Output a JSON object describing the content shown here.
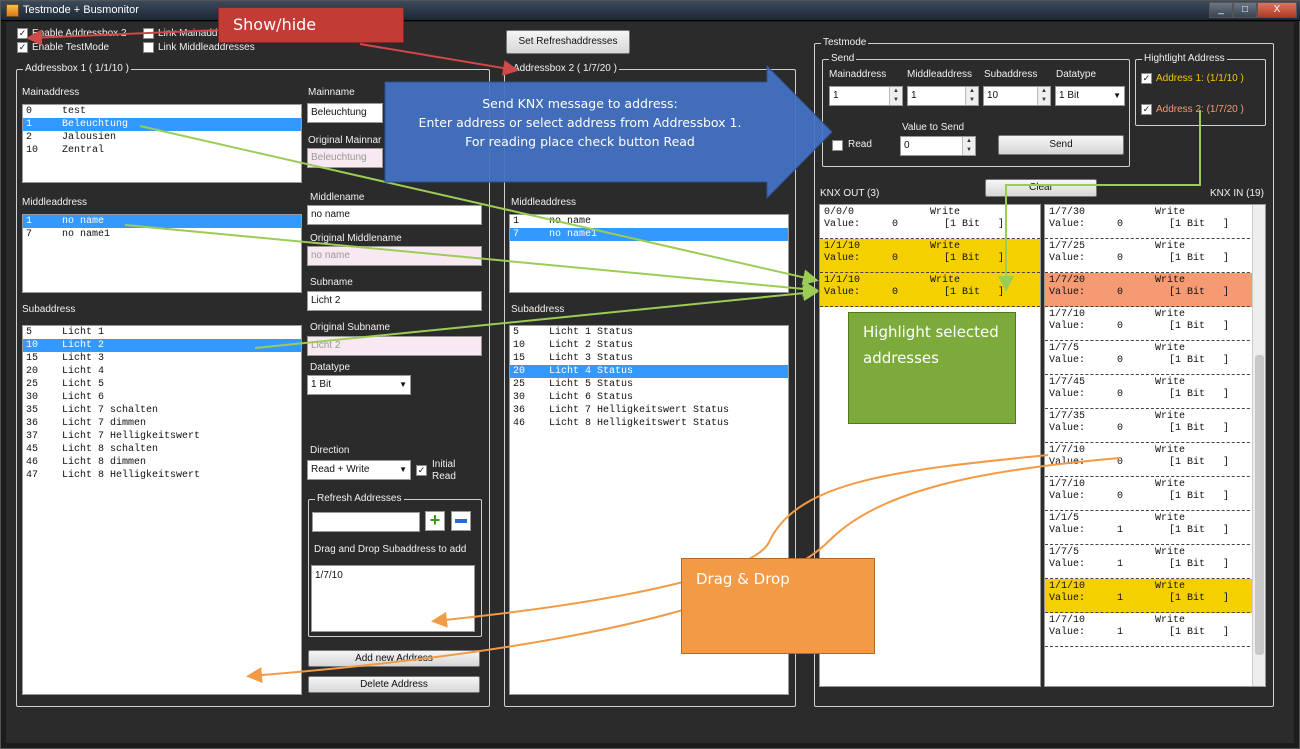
{
  "window": {
    "title": "Testmode + Busmonitor",
    "min": "_",
    "max": "□",
    "close": "X"
  },
  "toolbar": {
    "enable_addressbox2": "Enable Addressbox 2",
    "enable_testmode": "Enable TestMode",
    "link_mainaddresses": "Link Mainadd",
    "link_middleaddresses": "Link Middleaddresses",
    "set_refresh": "Set Refreshaddresses"
  },
  "addressbox1": {
    "title": "Addressbox 1 ( 1/1/10 )",
    "main_label": "Mainaddress",
    "main_items": [
      {
        "n": "0",
        "name": "test"
      },
      {
        "n": "1",
        "name": "Beleuchtung"
      },
      {
        "n": "2",
        "name": "Jalousien"
      },
      {
        "n": "10",
        "name": "Zentral"
      }
    ],
    "middle_label": "Middleaddress",
    "middle_items": [
      {
        "n": "1",
        "name": "no name"
      },
      {
        "n": "7",
        "name": "no name1"
      }
    ],
    "sub_label": "Subaddress",
    "sub_items": [
      {
        "n": "5",
        "name": "Licht 1"
      },
      {
        "n": "10",
        "name": "Licht 2"
      },
      {
        "n": "15",
        "name": "Licht 3"
      },
      {
        "n": "20",
        "name": "Licht 4"
      },
      {
        "n": "25",
        "name": "Licht 5"
      },
      {
        "n": "30",
        "name": "Licht 6"
      },
      {
        "n": "35",
        "name": "Licht 7 schalten"
      },
      {
        "n": "36",
        "name": "Licht 7 dimmen"
      },
      {
        "n": "37",
        "name": "Licht 7 Helligkeitswert"
      },
      {
        "n": "45",
        "name": "Licht 8 schalten"
      },
      {
        "n": "46",
        "name": "Licht 8 dimmen"
      },
      {
        "n": "47",
        "name": "Licht 8 Helligkeitswert"
      }
    ]
  },
  "details": {
    "mainname_label": "Mainname",
    "mainname_value": "Beleuchtung",
    "orig_mainname_label": "Original Mainnar",
    "orig_mainname_value": "Beleuchtung",
    "middlename_label": "Middlename",
    "middlename_value": "no name",
    "orig_middlename_label": "Original Middlename",
    "orig_middlename_value": "no name",
    "subname_label": "Subname",
    "subname_value": "Licht 2",
    "orig_subname_label": "Original Subname",
    "orig_subname_value": "Licht 2",
    "datatype_label": "Datatype",
    "datatype_value": "1 Bit",
    "direction_label": "Direction",
    "direction_value": "Read + Write",
    "initial_read": "Initial Read",
    "refresh_title": "Refresh Addresses",
    "dragdrop_hint": "Drag and Drop Subaddress to add",
    "refresh_items": [
      "1/7/10"
    ],
    "add_button": "Add new Address",
    "delete_button": "Delete Address"
  },
  "addressbox2": {
    "title": "Addressbox 2 ( 1/7/20 )",
    "middle_label": "Middleaddress",
    "middle_items": [
      {
        "n": "1",
        "name": "no name"
      },
      {
        "n": "7",
        "name": "no name1"
      }
    ],
    "sub_label": "Subaddress",
    "sub_items": [
      {
        "n": "5",
        "name": "Licht 1 Status"
      },
      {
        "n": "10",
        "name": "Licht 2 Status"
      },
      {
        "n": "15",
        "name": "Licht 3 Status"
      },
      {
        "n": "20",
        "name": "Licht 4 Status"
      },
      {
        "n": "25",
        "name": "Licht 5 Status"
      },
      {
        "n": "30",
        "name": "Licht 6 Status"
      },
      {
        "n": "36",
        "name": "Licht 7 Helligkeitswert Status"
      },
      {
        "n": "46",
        "name": "Licht 8 Helligkeitswert Status"
      }
    ]
  },
  "testmode": {
    "title": "Testmode",
    "send_title": "Send",
    "main_label": "Mainaddress",
    "main_value": "1",
    "middle_label": "Middleaddress",
    "middle_value": "1",
    "sub_label": "Subaddress",
    "sub_value": "10",
    "datatype_label": "Datatype",
    "datatype_value": "1 Bit",
    "read_label": "Read",
    "value_label": "Value to Send",
    "value_value": "0",
    "send_button": "Send",
    "highlight_title": "Hightlight Address",
    "hl1": "Address 1: (1/1/10 )",
    "hl2": "Address 2: (1/7/20 )",
    "clear_button": "Clear",
    "knx_out_label": "KNX OUT (3)",
    "knx_in_label": "KNX IN (19)",
    "value_prefix": "Value:",
    "knx_out": [
      {
        "addr": "0/0/0",
        "op": "Write",
        "val": "0",
        "type": "[1 Bit   ]",
        "hl": ""
      },
      {
        "addr": "1/1/10",
        "op": "Write",
        "val": "0",
        "type": "[1 Bit   ]",
        "hl": "y"
      },
      {
        "addr": "1/1/10",
        "op": "Write",
        "val": "0",
        "type": "[1 Bit   ]",
        "hl": "y"
      }
    ],
    "knx_in": [
      {
        "addr": "1/7/30",
        "op": "Write",
        "val": "0",
        "type": "[1 Bit   ]",
        "hl": ""
      },
      {
        "addr": "1/7/25",
        "op": "Write",
        "val": "0",
        "type": "[1 Bit   ]",
        "hl": ""
      },
      {
        "addr": "1/7/20",
        "op": "Write",
        "val": "0",
        "type": "[1 Bit   ]",
        "hl": "o"
      },
      {
        "addr": "1/7/10",
        "op": "Write",
        "val": "0",
        "type": "[1 Bit   ]",
        "hl": ""
      },
      {
        "addr": "1/7/5",
        "op": "Write",
        "val": "0",
        "type": "[1 Bit   ]",
        "hl": ""
      },
      {
        "addr": "1/7/45",
        "op": "Write",
        "val": "0",
        "type": "[1 Bit   ]",
        "hl": ""
      },
      {
        "addr": "1/7/35",
        "op": "Write",
        "val": "0",
        "type": "[1 Bit   ]",
        "hl": ""
      },
      {
        "addr": "1/7/10",
        "op": "Write",
        "val": "0",
        "type": "[1 Bit   ]",
        "hl": ""
      },
      {
        "addr": "1/7/10",
        "op": "Write",
        "val": "0",
        "type": "[1 Bit   ]",
        "hl": ""
      },
      {
        "addr": "1/1/5",
        "op": "Write",
        "val": "1",
        "type": "[1 Bit   ]",
        "hl": ""
      },
      {
        "addr": "1/7/5",
        "op": "Write",
        "val": "1",
        "type": "[1 Bit   ]",
        "hl": ""
      },
      {
        "addr": "1/1/10",
        "op": "Write",
        "val": "1",
        "type": "[1 Bit   ]",
        "hl": "y"
      },
      {
        "addr": "1/7/10",
        "op": "Write",
        "val": "1",
        "type": "[1 Bit   ]",
        "hl": ""
      }
    ]
  },
  "callouts": {
    "showhide": "Show/hide",
    "send_line1": "Send KNX message to address:",
    "send_line2": "Enter address or select address from Addressbox 1.",
    "send_line3": "For reading place check button Read",
    "highlight_line1": "Highlight selected",
    "highlight_line2": "addresses",
    "dragdrop": "Drag & Drop"
  },
  "colors": {
    "selection": "#3399ff",
    "highlight_yellow": "#f5d000",
    "highlight_orange": "#f59a72",
    "callout_red": "#c23b35",
    "callout_blue": "#4472c4",
    "callout_green": "#7cab3c",
    "callout_orange": "#f29a45"
  }
}
